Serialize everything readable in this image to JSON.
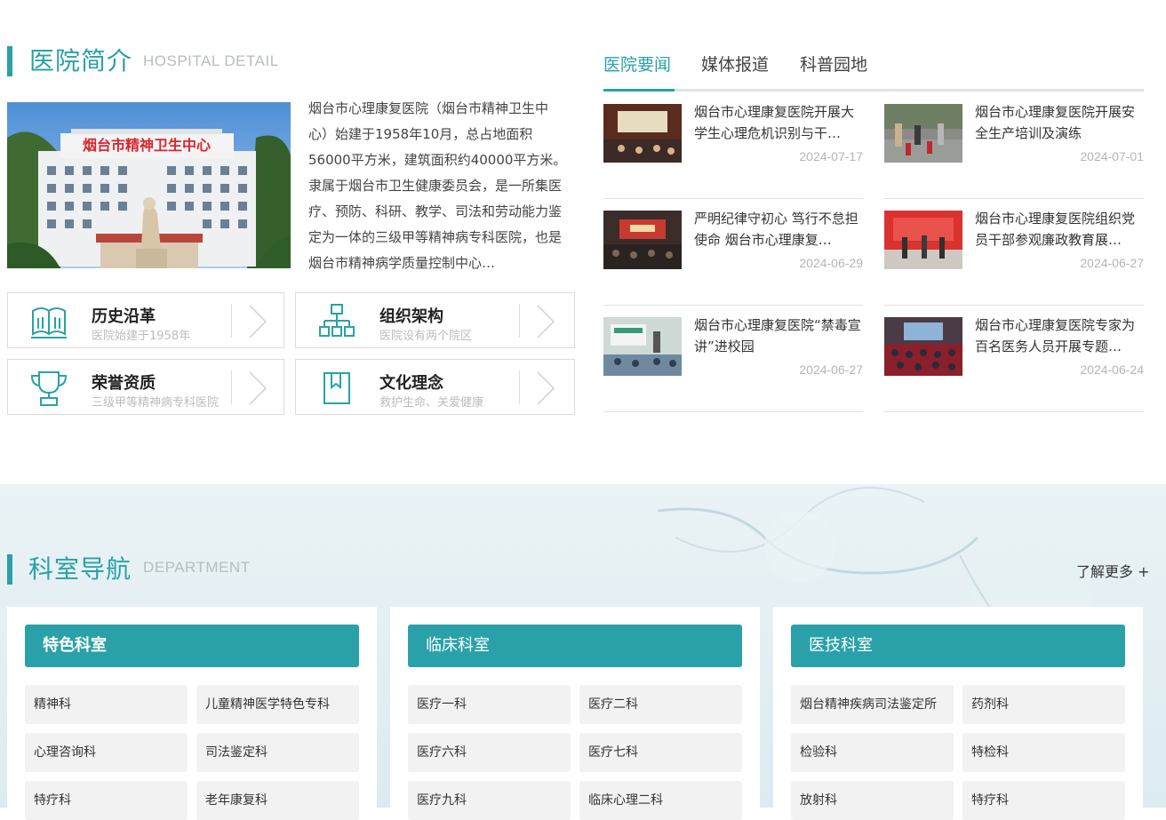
{
  "intro": {
    "heading_cn": "医院简介",
    "heading_en": "HOSPITAL DETAIL",
    "image_sign": "烟台市精神卫生中心",
    "text": "烟台市心理康复医院（烟台市精神卫生中心）始建于1958年10月，总占地面积56000平方米，建筑面积约40000平方米。隶属于烟台市卫生健康委员会，是一所集医疗、预防、科研、教学、司法和劳动能力鉴定为一体的三级甲等精神病专科医院，也是烟台市精神病学质量控制中心…",
    "cards": [
      {
        "title": "历史沿革",
        "sub": "医院始建于1958年",
        "icon": "book-icon"
      },
      {
        "title": "组织架构",
        "sub": "医院设有两个院区",
        "icon": "org-chart-icon"
      },
      {
        "title": "荣誉资质",
        "sub": "三级甲等精神病专科医院",
        "icon": "trophy-icon"
      },
      {
        "title": "文化理念",
        "sub": "救护生命、关爱健康",
        "icon": "bookmark-icon"
      }
    ]
  },
  "news": {
    "tabs": [
      "医院要闻",
      "媒体报道",
      "科普园地"
    ],
    "active_tab": "医院要闻",
    "items": [
      {
        "title": "烟台市心理康复医院开展大学生心理危机识别与干…",
        "date": "2024-07-17"
      },
      {
        "title": "烟台市心理康复医院开展安全生产培训及演练",
        "date": "2024-07-01"
      },
      {
        "title": "严明纪律守初心 笃行不怠担使命 烟台市心理康复…",
        "date": "2024-06-29"
      },
      {
        "title": "烟台市心理康复医院组织党员干部参观廉政教育展…",
        "date": "2024-06-27"
      },
      {
        "title": "烟台市心理康复医院“禁毒宣讲”进校园",
        "date": "2024-06-27"
      },
      {
        "title": "烟台市心理康复医院专家为百名医务人员开展专题…",
        "date": "2024-06-24"
      }
    ]
  },
  "dept": {
    "heading_cn": "科室导航",
    "heading_en": "DEPARTMENT",
    "more": "了解更多 +",
    "panels": [
      {
        "title": "特色科室",
        "items": [
          "精神科",
          "儿童精神医学特色专科",
          "心理咨询科",
          "司法鉴定科",
          "特疗科",
          "老年康复科"
        ]
      },
      {
        "title": "临床科室",
        "items": [
          "医疗一科",
          "医疗二科",
          "医疗六科",
          "医疗七科",
          "医疗九科",
          "临床心理二科"
        ]
      },
      {
        "title": "医技科室",
        "items": [
          "烟台精神疾病司法鉴定所",
          "药剂科",
          "检验科",
          "特检科",
          "放射科",
          "特疗科"
        ]
      }
    ]
  },
  "colors": {
    "accent": "#2aa1a8",
    "border": "#dcdcdc",
    "muted": "#b7bcbf"
  }
}
